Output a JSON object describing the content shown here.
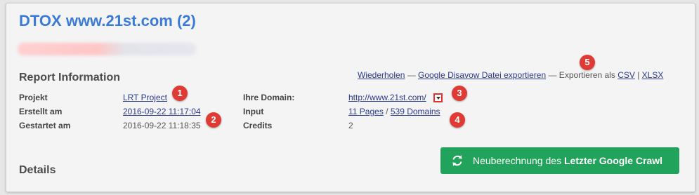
{
  "title": "DTOX www.21st.com (2)",
  "section_report": "Report Information",
  "section_details": "Details",
  "actions": {
    "repeat": "Wiederholen",
    "sep1": " — ",
    "disavow": "Google Disavow Datei exportieren",
    "sep2": " — Exportieren als ",
    "csv": "CSV",
    "pipe": " | ",
    "xlsx": "XLSX"
  },
  "info": {
    "project_label": "Projekt",
    "project_value": "LRT Project",
    "created_label": "Erstellt am",
    "created_value": "2016-09-22 11:17:04",
    "started_label": "Gestartet am",
    "started_value": "2016-09-22 11:18:35",
    "domain_label": "Ihre Domain:",
    "domain_value": "http://www.21st.com/",
    "input_label": "Input",
    "input_pages": "11 Pages",
    "input_sep": " / ",
    "input_domains": "539 Domains",
    "credits_label": "Credits",
    "credits_value": "2"
  },
  "badges": [
    "1",
    "2",
    "3",
    "4",
    "5"
  ],
  "recalc_button": {
    "prefix": "Neuberechnung des ",
    "bold": "Letzter Google Crawl",
    "icon": "refresh-icon"
  },
  "colors": {
    "title": "#3b7bd6",
    "link": "#2b3a8c",
    "badge": "#df3b34",
    "button": "#21a35b"
  }
}
